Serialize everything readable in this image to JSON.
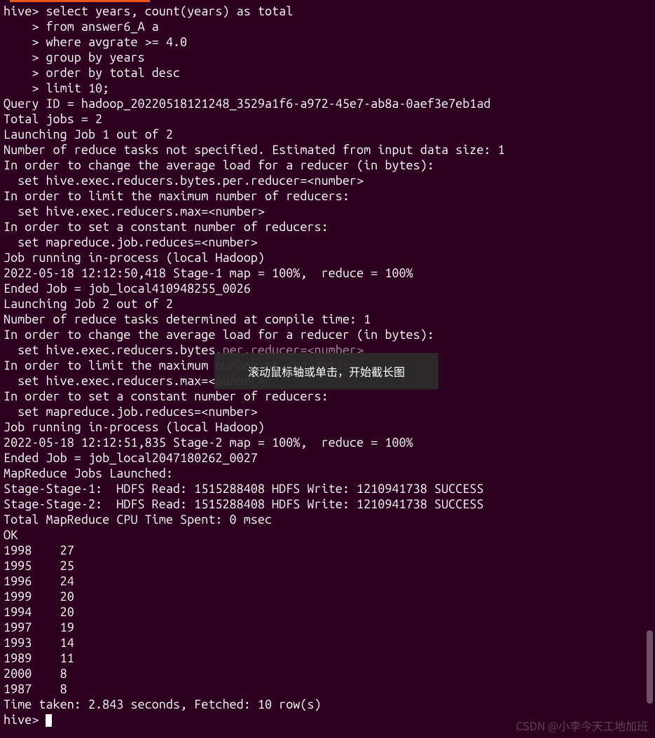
{
  "top_accent": true,
  "prompt1": "hive> ",
  "cont_prompt": "    > ",
  "query": {
    "l1": "select years, count(years) as total",
    "l2": "from answer6_A a",
    "l3": "where avgrate >= 4.0",
    "l4": "group by years",
    "l5": "order by total desc",
    "l6": "limit 10;"
  },
  "out": {
    "l01": "Query ID = hadoop_20220518121248_3529a1f6-a972-45e7-ab8a-0aef3e7eb1ad",
    "l02": "Total jobs = 2",
    "l03": "Launching Job 1 out of 2",
    "l04": "Number of reduce tasks not specified. Estimated from input data size: 1",
    "l05": "In order to change the average load for a reducer (in bytes):",
    "l06": "  set hive.exec.reducers.bytes.per.reducer=<number>",
    "l07": "In order to limit the maximum number of reducers:",
    "l08": "  set hive.exec.reducers.max=<number>",
    "l09": "In order to set a constant number of reducers:",
    "l10": "  set mapreduce.job.reduces=<number>",
    "l11": "Job running in-process (local Hadoop)",
    "l12": "2022-05-18 12:12:50,418 Stage-1 map = 100%,  reduce = 100%",
    "l13": "Ended Job = job_local410948255_0026",
    "l14": "Launching Job 2 out of 2",
    "l15": "Number of reduce tasks determined at compile time: 1",
    "l16": "In order to change the average load for a reducer (in bytes):",
    "l17a": "  set hive.exec.reducers.bytes",
    "l17b": ".per.reducer=<number>",
    "l18a": "In order to limit the maximum ",
    "l18b": "number of reducers:",
    "l19a": "  set hive.exec.reducers.max=<",
    "l19b": "number>",
    "l20": "In order to set a constant number of reducers:",
    "l21": "  set mapreduce.job.reduces=<number>",
    "l22": "Job running in-process (local Hadoop)",
    "l23": "2022-05-18 12:12:51,835 Stage-2 map = 100%,  reduce = 100%",
    "l24": "Ended Job = job_local2047180262_0027",
    "l25": "MapReduce Jobs Launched: ",
    "l26": "Stage-Stage-1:  HDFS Read: 1515288408 HDFS Write: 1210941738 SUCCESS",
    "l27": "Stage-Stage-2:  HDFS Read: 1515288408 HDFS Write: 1210941738 SUCCESS",
    "l28": "Total MapReduce CPU Time Spent: 0 msec",
    "l29": "OK"
  },
  "results": [
    {
      "year": "1998",
      "total": "27"
    },
    {
      "year": "1995",
      "total": "25"
    },
    {
      "year": "1996",
      "total": "24"
    },
    {
      "year": "1999",
      "total": "20"
    },
    {
      "year": "1994",
      "total": "20"
    },
    {
      "year": "1997",
      "total": "19"
    },
    {
      "year": "1993",
      "total": "14"
    },
    {
      "year": "1989",
      "total": "11"
    },
    {
      "year": "2000",
      "total": "8"
    },
    {
      "year": "1987",
      "total": "8"
    }
  ],
  "footer": {
    "time": "Time taken: 2.843 seconds, Fetched: 10 row(s)",
    "prompt": "hive> "
  },
  "tooltip": "滚动鼠标轴或单击，开始截长图",
  "watermark": "CSDN @小李今天工地加班"
}
